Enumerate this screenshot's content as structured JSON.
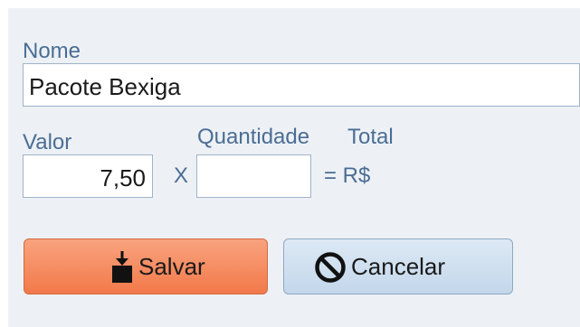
{
  "form": {
    "nome_label": "Nome",
    "nome_value": "Pacote Bexiga",
    "valor_label": "Valor",
    "valor_value": "7,50",
    "multiply_symbol": "X",
    "quantidade_label": "Quantidade",
    "quantidade_value": "",
    "total_label": "Total",
    "total_prefix": "= R$",
    "total_value": ""
  },
  "buttons": {
    "salvar_label": "Salvar",
    "salvar_icon": "save-icon",
    "cancelar_label": "Cancelar",
    "cancelar_icon": "cancel-icon"
  },
  "colors": {
    "label": "#4b6d94",
    "panel_bg": "#edf1f5",
    "salvar_bg": "#f58a5f",
    "cancelar_bg": "#cfe0f0"
  }
}
